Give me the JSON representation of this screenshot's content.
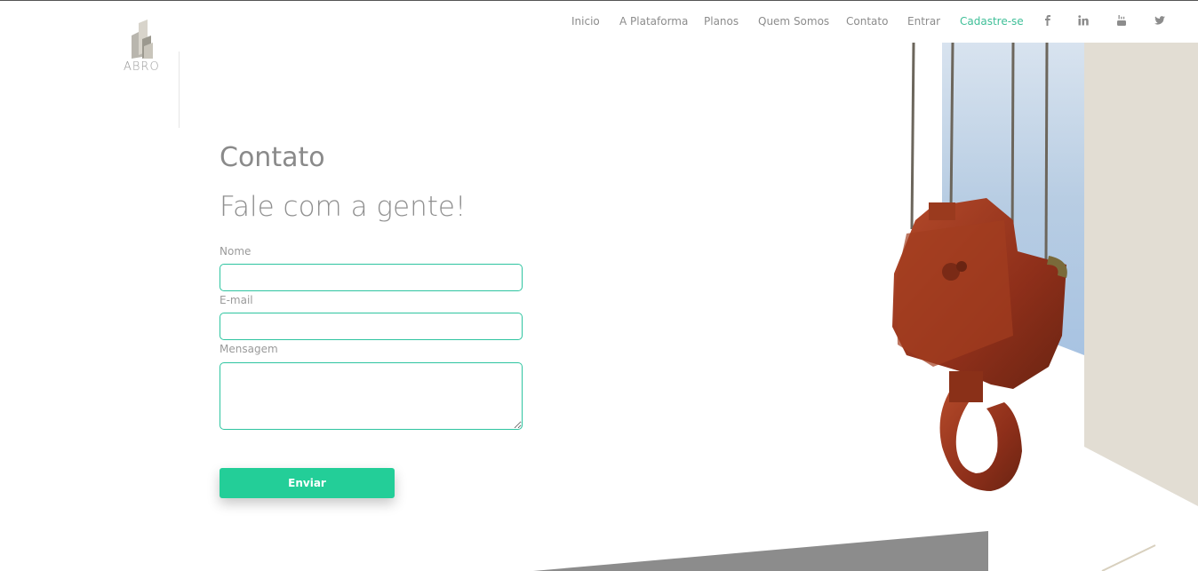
{
  "brand": {
    "name": "ABRO"
  },
  "nav": {
    "items": [
      {
        "label": "Inicio"
      },
      {
        "label": "A Plataforma"
      },
      {
        "label": "Planos"
      },
      {
        "label": "Quem Somos"
      },
      {
        "label": "Contato"
      },
      {
        "label": "Entrar"
      },
      {
        "label": "Cadastre-se"
      }
    ],
    "social": [
      "facebook-icon",
      "linkedin-icon",
      "youtube-icon",
      "twitter-icon"
    ]
  },
  "page": {
    "title": "Contato",
    "subtitle": "Fale com a gente!"
  },
  "form": {
    "name_label": "Nome",
    "name_value": "",
    "email_label": "E-mail",
    "email_value": "",
    "message_label": "Mensagem",
    "message_value": "",
    "submit_label": "Enviar"
  },
  "colors": {
    "accent": "#23ce98",
    "border": "#2ec4a0",
    "text": "#8a8a8a"
  }
}
